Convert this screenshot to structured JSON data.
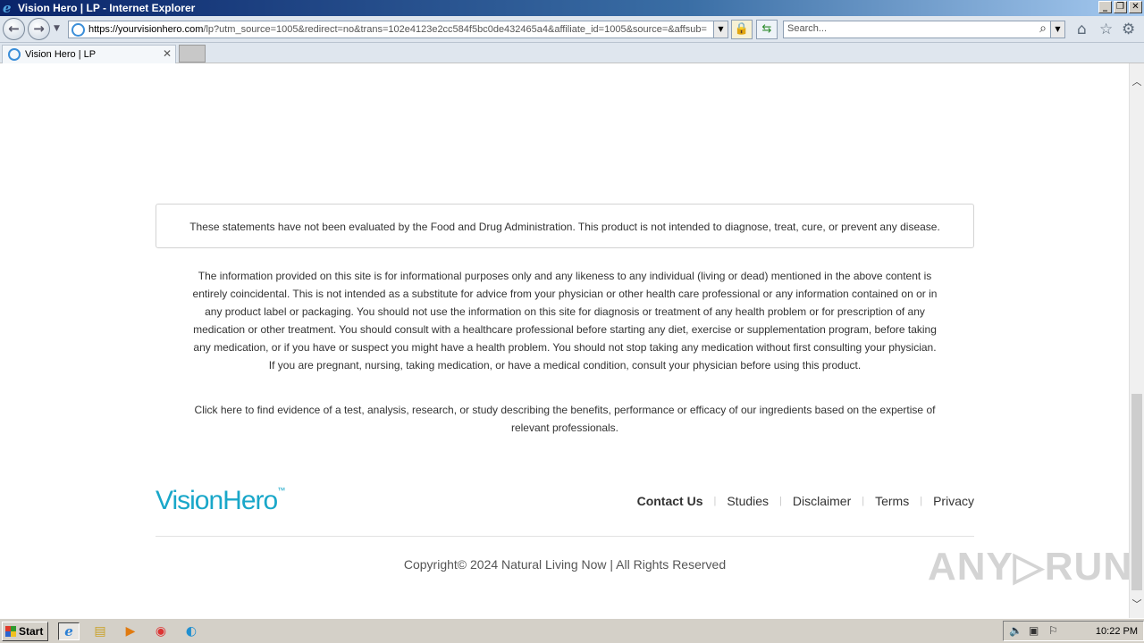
{
  "window": {
    "title": "Vision Hero | LP - Internet Explorer"
  },
  "navbar": {
    "url_host": "https://yourvisionhero.com",
    "url_rest": "/lp?utm_source=1005&redirect=no&trans=102e4123e2cc584f5bc0de432465a4&affiliate_id=1005&source=&affsub=",
    "search_placeholder": "Search..."
  },
  "tabs": [
    {
      "label": "Vision Hero | LP"
    }
  ],
  "content": {
    "fda_notice": "These statements have not been evaluated by the Food and Drug Administration. This product is not intended to diagnose, treat, cure, or prevent any disease.",
    "disclaimer": "The information provided on this site is for informational purposes only and any likeness to any individual (living or dead) mentioned in the above content is entirely coincidental. This is not intended as a substitute for advice from your physician or other health care professional or any information contained on or in any product label or packaging. You should not use the information on this site for diagnosis or treatment of any health problem or for prescription of any medication or other treatment. You should consult with a healthcare professional before starting any diet, exercise or supplementation program, before taking any medication, or if you have or suspect you might have a health problem. You should not stop taking any medication without first consulting your physician. If you are pregnant, nursing, taking medication, or have a medical condition, consult your physician before using this product.",
    "evidence_link": "Click here to find",
    "evidence_text": " evidence of a test, analysis, research, or study describing the benefits, performance or efficacy of our ingredients based on the expertise of relevant professionals."
  },
  "footer": {
    "logo_text": "VisionHero",
    "logo_tm": "™",
    "links": [
      "Contact Us",
      "Studies",
      "Disclaimer",
      "Terms",
      "Privacy"
    ],
    "copyright": "Copyright© 2024 Natural Living Now | All Rights Reserved"
  },
  "watermark": "ANY▷RUN",
  "taskbar": {
    "start_label": "Start",
    "clock": "10:22 PM"
  },
  "colors": {
    "brand": "#19a7c9",
    "titlebar": "#0a246a"
  }
}
